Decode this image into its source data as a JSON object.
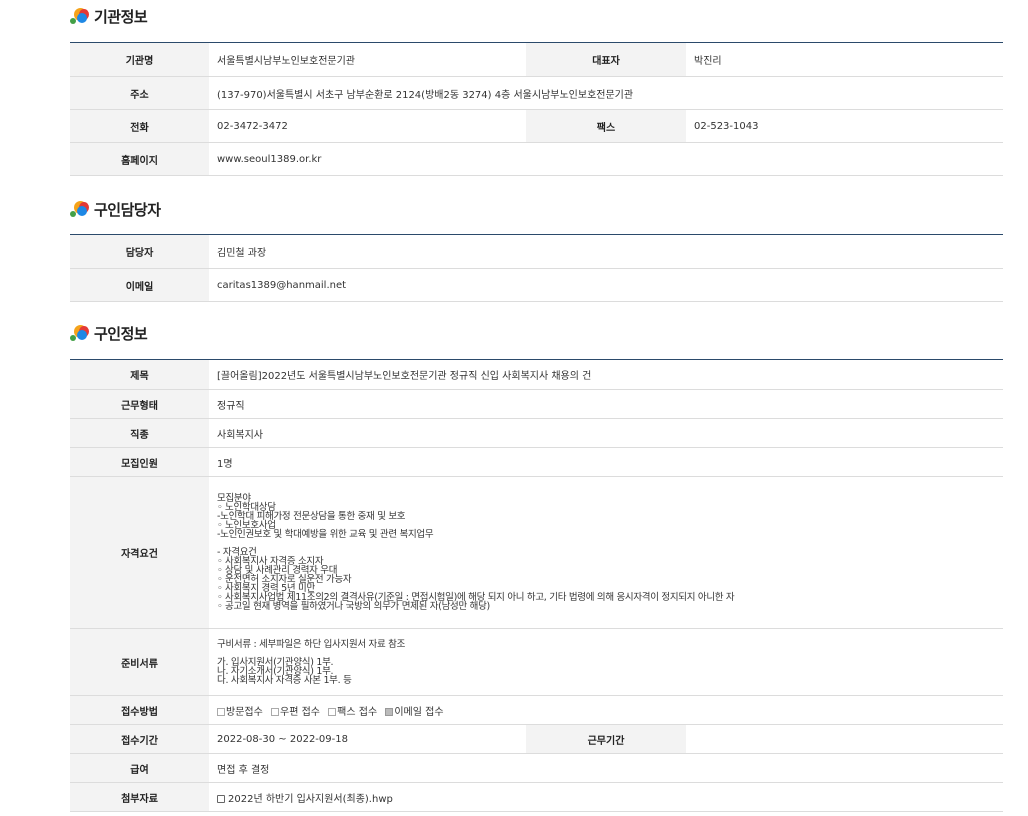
{
  "sections": {
    "org": {
      "title": "기관정보"
    },
    "contact": {
      "title": "구인담당자"
    },
    "job": {
      "title": "구인정보"
    }
  },
  "org": {
    "name_label": "기관명",
    "name": "서울특별시남부노인보호전문기관",
    "rep_label": "대표자",
    "rep": "박진리",
    "addr_label": "주소",
    "addr": "(137-970)서울특별시 서초구 남부순환로 2124(방배2동 3274) 4층 서울시남부노인보호전문기관",
    "tel_label": "전화",
    "tel": "02-3472-3472",
    "fax_label": "팩스",
    "fax": "02-523-1043",
    "web_label": "홈페이지",
    "web": "www.seoul1389.or.kr"
  },
  "contact": {
    "person_label": "담당자",
    "person": "김민철 과장",
    "email_label": "이메일",
    "email": "caritas1389@hanmail.net"
  },
  "job": {
    "title_label": "제목",
    "title": "[끌어올림]2022년도 서울특별시남부노인보호전문기관 정규직 신입 사회복지사 채용의 건",
    "type_label": "근무형태",
    "type": "정규직",
    "kind_label": "직종",
    "kind": "사회복지사",
    "count_label": "모집인원",
    "count": "1명",
    "qual_label": "자격요건",
    "qual_lines": [
      "모집분야",
      "◦ 노인학대상담",
      "-노인학대 피해가정 전문상담을 통한 중재 및 보호",
      "◦ 노인보호사업",
      "-노인인권보호 및 학대예방을 위한  교육 및 관련 복지업무",
      "",
      "- 자격요건",
      "◦ 사회복지사 자격증 소지자",
      "◦ 상담 및 사례관리 경력자 우대",
      "◦ 운전면허 소지자로 실운전 가능자",
      "◦ 사회복지 경력 5년 미만",
      "◦ 사회복지사업법 제11조의2의 결격사유(기준일 : 면접시험일)에 해당 되지 아니 하고, 기타 법령에 의해 응시자격이 정지되지 아니한 자",
      "◦ 공고일 현재 병역을 필하였거나 국방의 의무가 면제된 자(남성만 해당)"
    ],
    "docs_label": "준비서류",
    "docs_lines": [
      "구비서류 :  세부파일은 하단 입사지원서 자료 참조",
      "",
      "가. 입사지원서(기관양식) 1부.",
      "나. 자기소개서(기관양식) 1부.",
      "다. 사회복지사 자격증 사본 1부. 등"
    ],
    "method_label": "접수방법",
    "methods": [
      {
        "label": "방문접수",
        "checked": false
      },
      {
        "label": "우편 접수",
        "checked": false
      },
      {
        "label": "팩스 접수",
        "checked": false
      },
      {
        "label": "이메일 접수",
        "checked": true
      }
    ],
    "period_label": "접수기간",
    "period": "2022-08-30 ~ 2022-09-18",
    "workhours_label": "근무기간",
    "workhours": "",
    "pay_label": "급여",
    "pay": "면접 후 결정",
    "attach_label": "첨부자료",
    "attach": "2022년 하반기 입사지원서(최종).hwp"
  }
}
